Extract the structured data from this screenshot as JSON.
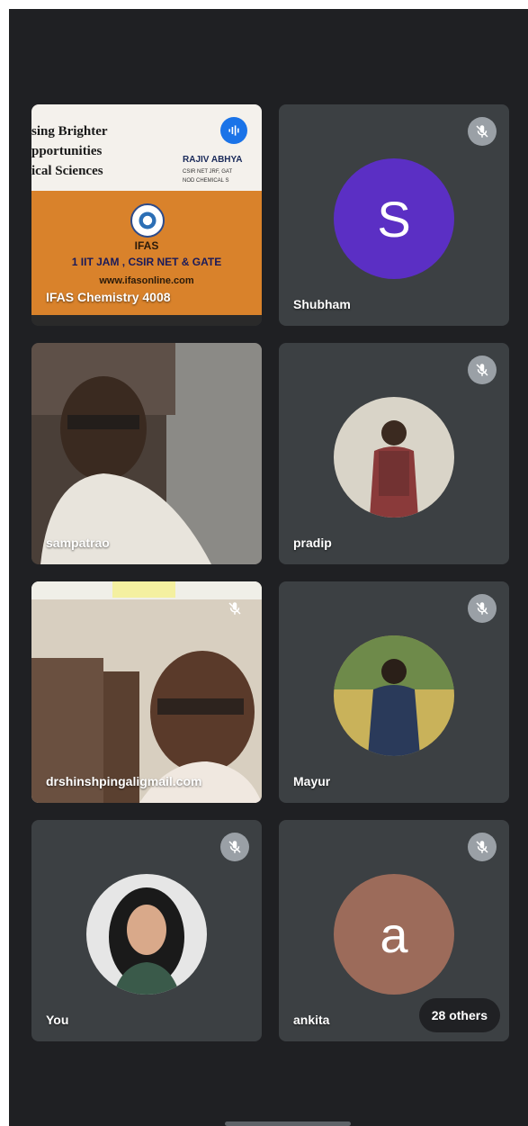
{
  "participants": [
    {
      "name": "IFAS Chemistry 4008"
    },
    {
      "name": "Shubham",
      "initial": "S",
      "avatar_color": "#5b2fc4"
    },
    {
      "name": "sampatrao"
    },
    {
      "name": "pradip"
    },
    {
      "name": "drshinshpingaligmail.com"
    },
    {
      "name": "Mayur"
    },
    {
      "name": "You"
    },
    {
      "name": "ankita",
      "initial": "a",
      "avatar_color": "#9c6b5a"
    }
  ],
  "others_count": "28 others",
  "slide": {
    "line1": "sing Brighter",
    "line2": "pportunities",
    "line3": "ical Sciences",
    "right_title": "RAJIV ABHYA",
    "right_sub1": "CSIR NET JRF, GAT",
    "right_sub2": "NOD CHEMICAL S",
    "ifas_title": "IFAS",
    "ifas_sub": "1 IIT JAM , CSIR NET & GATE",
    "ifas_url": "www.ifasonline.com"
  }
}
